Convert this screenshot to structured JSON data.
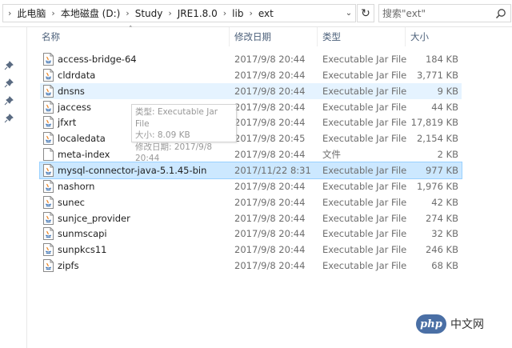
{
  "breadcrumbs": [
    "此电脑",
    "本地磁盘 (D:)",
    "Study",
    "JRE1.8.0",
    "lib",
    "ext"
  ],
  "search": {
    "placeholder": "搜索\"ext\""
  },
  "columns": {
    "name": "名称",
    "date": "修改日期",
    "type": "类型",
    "size": "大小"
  },
  "files": [
    {
      "name": "access-bridge-64",
      "date": "2017/9/8 20:44",
      "type": "Executable Jar File",
      "size": "184 KB",
      "icon": "jar-file-icon"
    },
    {
      "name": "cldrdata",
      "date": "2017/9/8 20:44",
      "type": "Executable Jar File",
      "size": "3,771 KB",
      "icon": "jar-file-icon"
    },
    {
      "name": "dnsns",
      "date": "2017/9/8 20:44",
      "type": "Executable Jar File",
      "size": "9 KB",
      "icon": "jar-file-icon"
    },
    {
      "name": "jaccess",
      "date": "2017/9/8 20:44",
      "type": "Executable Jar File",
      "size": "44 KB",
      "icon": "jar-file-icon"
    },
    {
      "name": "jfxrt",
      "date": "2017/9/8 20:44",
      "type": "Executable Jar File",
      "size": "17,819 KB",
      "icon": "jar-file-icon"
    },
    {
      "name": "localedata",
      "date": "2017/9/8 20:45",
      "type": "Executable Jar File",
      "size": "2,154 KB",
      "icon": "jar-file-icon"
    },
    {
      "name": "meta-index",
      "date": "2017/9/8 20:44",
      "type": "文件",
      "size": "2 KB",
      "icon": "blank-file-icon"
    },
    {
      "name": "mysql-connector-java-5.1.45-bin",
      "date": "2017/11/22 8:31",
      "type": "Executable Jar File",
      "size": "977 KB",
      "icon": "jar-file-icon"
    },
    {
      "name": "nashorn",
      "date": "2017/9/8 20:44",
      "type": "Executable Jar File",
      "size": "1,976 KB",
      "icon": "jar-file-icon"
    },
    {
      "name": "sunec",
      "date": "2017/9/8 20:44",
      "type": "Executable Jar File",
      "size": "42 KB",
      "icon": "jar-file-icon"
    },
    {
      "name": "sunjce_provider",
      "date": "2017/9/8 20:44",
      "type": "Executable Jar File",
      "size": "274 KB",
      "icon": "jar-file-icon"
    },
    {
      "name": "sunmscapi",
      "date": "2017/9/8 20:44",
      "type": "Executable Jar File",
      "size": "32 KB",
      "icon": "jar-file-icon"
    },
    {
      "name": "sunpkcs11",
      "date": "2017/9/8 20:44",
      "type": "Executable Jar File",
      "size": "246 KB",
      "icon": "jar-file-icon"
    },
    {
      "name": "zipfs",
      "date": "2017/9/8 20:44",
      "type": "Executable Jar File",
      "size": "68 KB",
      "icon": "jar-file-icon"
    }
  ],
  "hovered_file": "dnsns",
  "selected_file": "mysql-connector-java-5.1.45-bin",
  "tooltip": {
    "type_line": "类型: Executable Jar File",
    "size_line": "大小: 8.09 KB",
    "date_line": "修改日期: 2017/9/8 20:44"
  },
  "watermark": {
    "logo_text": "php",
    "text": "中文网"
  },
  "colors": {
    "selected": "#cce8ff",
    "hover": "#e5f3ff",
    "header_text": "#4c607a"
  }
}
